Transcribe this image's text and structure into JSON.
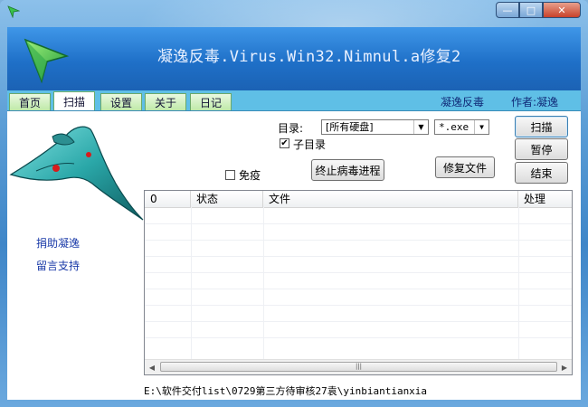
{
  "window": {
    "icon": "green-arrow-logo-icon",
    "controls": {
      "minimize": "—",
      "maximize": "□",
      "close": "✕"
    }
  },
  "header": {
    "title": "凝逸反毒.Virus.Win32.Nimnul.a修复2",
    "logo_icon": "green-arrow-logo-icon"
  },
  "tabs": [
    {
      "label": "首页",
      "active": false
    },
    {
      "label": "扫描",
      "active": true
    },
    {
      "label": "设置",
      "active": false
    },
    {
      "label": "关于",
      "active": false
    },
    {
      "label": "日记",
      "active": false
    }
  ],
  "tab_right": {
    "brand": "凝逸反毒",
    "author": "作者:凝逸"
  },
  "sidebar": {
    "image_icon": "alien-spaceship-image",
    "links": [
      "捐助凝逸",
      "留言支持"
    ]
  },
  "scan": {
    "dir_label": "目录:",
    "dir_value": "[所有硬盘]",
    "ext_value": "*.exe",
    "subdir_label": "子目录",
    "subdir_checked": true,
    "immune_label": "免疫",
    "immune_checked": false,
    "kill_process_button": "终止病毒进程",
    "repair_file_button": "修复文件",
    "scan_button": "扫描",
    "pause_button": "暂停",
    "end_button": "结束"
  },
  "list": {
    "columns": [
      "0",
      "状态",
      "文件",
      "处理"
    ],
    "rows": []
  },
  "status": {
    "path": "E:\\软件交付list\\0729第三方待审核27袁\\yinbiantianxia"
  },
  "colors": {
    "header_blue": "#1f70c8",
    "tab_bar": "#5fbfe6",
    "link_blue": "#1a3aa8"
  }
}
